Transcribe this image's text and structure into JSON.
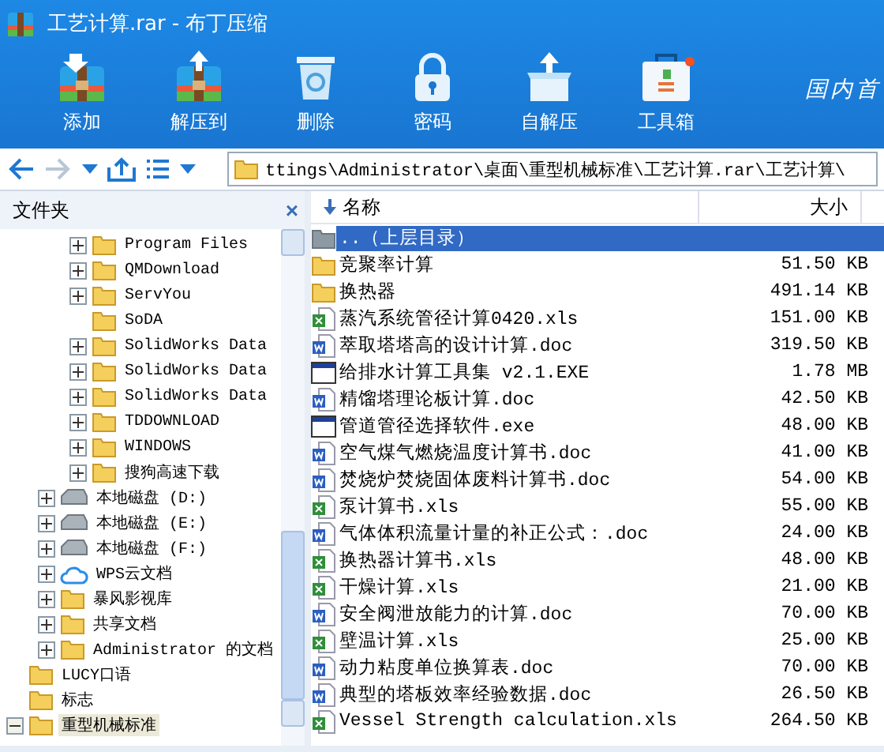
{
  "window": {
    "title": "工艺计算.rar - 布丁压缩"
  },
  "toolbar": [
    {
      "kind": "add",
      "label": "添加"
    },
    {
      "kind": "extract",
      "label": "解压到"
    },
    {
      "kind": "delete",
      "label": "删除"
    },
    {
      "kind": "password",
      "label": "密码"
    },
    {
      "kind": "sfx",
      "label": "自解压"
    },
    {
      "kind": "toolbox",
      "label": "工具箱"
    }
  ],
  "slogan": "国内首",
  "address": "ttings\\Administrator\\桌面\\重型机械标准\\工艺计算.rar\\工艺计算\\",
  "folders_panel": {
    "title": "文件夹",
    "close": "×",
    "tree": [
      {
        "children": [
          {
            "children": [
              {
                "label": "Program Files",
                "kind": "folder",
                "expanded": false,
                "selected": false
              },
              {
                "label": "QMDownload",
                "kind": "folder",
                "expanded": false,
                "selected": false
              },
              {
                "label": "ServYou",
                "kind": "folder",
                "expanded": false,
                "selected": false
              },
              {
                "label": "SoDA",
                "kind": "folder",
                "selected": false
              },
              {
                "label": "SolidWorks Data",
                "kind": "folder",
                "expanded": false,
                "selected": false
              },
              {
                "label": "SolidWorks Data",
                "kind": "folder",
                "expanded": false,
                "selected": false
              },
              {
                "label": "SolidWorks Data",
                "kind": "folder",
                "expanded": false,
                "selected": false
              },
              {
                "label": "TDDOWNLOAD",
                "kind": "folder",
                "expanded": false,
                "selected": false
              },
              {
                "label": "WINDOWS",
                "kind": "folder",
                "expanded": false,
                "selected": false
              },
              {
                "label": "搜狗高速下载",
                "kind": "folder",
                "expanded": false,
                "selected": false
              }
            ]
          },
          {
            "label": "本地磁盘 (D:)",
            "kind": "drive",
            "expanded": false,
            "selected": false
          },
          {
            "label": "本地磁盘 (E:)",
            "kind": "drive",
            "expanded": false,
            "selected": false
          },
          {
            "label": "本地磁盘 (F:)",
            "kind": "drive",
            "expanded": false,
            "selected": false
          },
          {
            "label": "WPS云文档",
            "kind": "cloud",
            "expanded": false,
            "selected": false
          },
          {
            "label": "暴风影视库",
            "kind": "folder",
            "expanded": false,
            "selected": false
          },
          {
            "label": "共享文档",
            "kind": "folder",
            "expanded": false,
            "selected": false
          },
          {
            "label": "Administrator 的文档",
            "kind": "folder",
            "expanded": false,
            "selected": false
          }
        ]
      },
      {
        "label": "LUCY口语",
        "kind": "folder",
        "selected": false
      },
      {
        "label": "标志",
        "kind": "folder",
        "selected": false
      },
      {
        "label": "重型机械标准",
        "kind": "folder",
        "expanded": true,
        "selected": true
      }
    ]
  },
  "file_list": {
    "columns": [
      "名称",
      "大小"
    ],
    "rows": [
      {
        "kind": "parent",
        "name": "..（上层目录）",
        "size": "",
        "selected": true
      },
      {
        "kind": "folder",
        "name": "竞聚率计算",
        "size": "51.50 KB",
        "selected": false
      },
      {
        "kind": "folder",
        "name": "换热器",
        "size": "491.14 KB",
        "selected": false
      },
      {
        "kind": "xls",
        "name": "蒸汽系统管径计算0420.xls",
        "size": "151.00 KB",
        "selected": false
      },
      {
        "kind": "doc",
        "name": "萃取塔塔高的设计计算.doc",
        "size": "319.50 KB",
        "selected": false
      },
      {
        "kind": "exe",
        "name": "给排水计算工具集 v2.1.EXE",
        "size": "1.78 MB",
        "selected": false
      },
      {
        "kind": "doc",
        "name": "精馏塔理论板计算.doc",
        "size": "42.50 KB",
        "selected": false
      },
      {
        "kind": "exe",
        "name": "管道管径选择软件.exe",
        "size": "48.00 KB",
        "selected": false
      },
      {
        "kind": "doc",
        "name": "空气煤气燃烧温度计算书.doc",
        "size": "41.00 KB",
        "selected": false
      },
      {
        "kind": "doc",
        "name": "焚烧炉焚烧固体废料计算书.doc",
        "size": "54.00 KB",
        "selected": false
      },
      {
        "kind": "xls",
        "name": "泵计算书.xls",
        "size": "55.00 KB",
        "selected": false
      },
      {
        "kind": "doc",
        "name": "气体体积流量计量的补正公式：.doc",
        "size": "24.00 KB",
        "selected": false
      },
      {
        "kind": "xls",
        "name": "换热器计算书.xls",
        "size": "48.00 KB",
        "selected": false
      },
      {
        "kind": "xls",
        "name": "干燥计算.xls",
        "size": "21.00 KB",
        "selected": false
      },
      {
        "kind": "doc",
        "name": "安全阀泄放能力的计算.doc",
        "size": "70.00 KB",
        "selected": false
      },
      {
        "kind": "xls",
        "name": "壁温计算.xls",
        "size": "25.00 KB",
        "selected": false
      },
      {
        "kind": "doc",
        "name": "动力粘度单位换算表.doc",
        "size": "70.00 KB",
        "selected": false
      },
      {
        "kind": "doc",
        "name": "典型的塔板效率经验数据.doc",
        "size": "26.50 KB",
        "selected": false
      },
      {
        "kind": "xls",
        "name": "Vessel Strength calculation.xls",
        "size": "264.50 KB",
        "selected": false
      }
    ]
  }
}
